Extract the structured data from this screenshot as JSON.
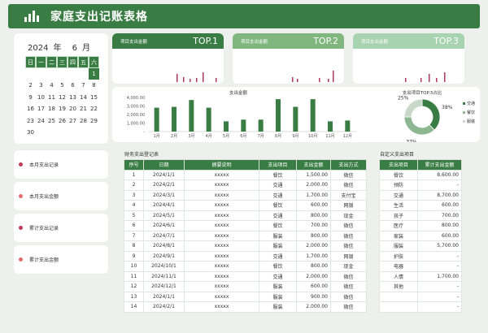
{
  "app": {
    "title": "家庭支出记账表格"
  },
  "calendar": {
    "year": "2024",
    "year_unit": "年",
    "month": "6",
    "month_unit": "月",
    "weekdays": [
      "日",
      "一",
      "二",
      "三",
      "四",
      "五",
      "六"
    ],
    "weeks": [
      [
        "",
        "",
        "",
        "",
        "",
        "",
        "1"
      ],
      [
        "2",
        "3",
        "4",
        "5",
        "6",
        "7",
        "8"
      ],
      [
        "9",
        "10",
        "11",
        "12",
        "13",
        "14",
        "15"
      ],
      [
        "16",
        "17",
        "18",
        "19",
        "20",
        "21",
        "22"
      ],
      [
        "23",
        "24",
        "25",
        "26",
        "27",
        "28",
        "29"
      ],
      [
        "30",
        "",
        "",
        "",
        "",
        "",
        ""
      ]
    ],
    "selected_day": "1"
  },
  "nav": [
    {
      "label": "本月支出记录",
      "dot_color": "#c0395b"
    },
    {
      "label": "本月支出金额",
      "dot_color": "#e86a6a"
    },
    {
      "label": "累计支出记录",
      "dot_color": "#c0395b"
    },
    {
      "label": "累计支出金额",
      "dot_color": "#e86a6a"
    }
  ],
  "top_cards": [
    {
      "label": "项目支出金额",
      "rank": "TOP.1",
      "color": "#3a7d44"
    },
    {
      "label": "项目支出金额",
      "rank": "TOP.2",
      "color": "#7fb77e"
    },
    {
      "label": "项目支出金额",
      "rank": "TOP.3",
      "color": "#a8d3b0"
    }
  ],
  "sections": {
    "ledger_title": "财务支出登记表",
    "custom_title": "自定义支出项目"
  },
  "chart_data": [
    {
      "type": "bar",
      "title": "支出金额",
      "categories": [
        "1月",
        "2月",
        "3月",
        "4月",
        "5月",
        "6月",
        "7月",
        "8月",
        "9月",
        "10月",
        "11月",
        "12月"
      ],
      "values": [
        2800,
        2900,
        3700,
        2800,
        1200,
        1400,
        1400,
        3800,
        2900,
        3800,
        1200,
        1300
      ],
      "y_ticks": [
        "4,000.00",
        "3,000.00",
        "2,000.00",
        "1,000.00",
        "-"
      ],
      "ylim": [
        0,
        4000
      ]
    },
    {
      "type": "pie",
      "title": "支出项目TOP.3占比",
      "labels": [
        "交通",
        "餐饮",
        "服装"
      ],
      "values": [
        38,
        37,
        25
      ],
      "value_labels": [
        "38%",
        "37%",
        "25%"
      ],
      "colors": [
        "#3a7d44",
        "#8cb790",
        "#c8d9c9"
      ]
    }
  ],
  "ledger": {
    "headers": [
      "序号",
      "日期",
      "摘要说明",
      "支出项目",
      "支出金额",
      "支出方式"
    ],
    "rows": [
      [
        "1",
        "2024/1/1",
        "xxxxx",
        "餐饮",
        "1,500.00",
        "微信"
      ],
      [
        "2",
        "2024/2/1",
        "xxxxx",
        "交通",
        "2,000.00",
        "微信"
      ],
      [
        "3",
        "2024/3/1",
        "xxxxx",
        "交通",
        "1,700.00",
        "支付宝"
      ],
      [
        "4",
        "2024/4/1",
        "xxxxx",
        "餐饮",
        "600.00",
        "网银"
      ],
      [
        "5",
        "2024/5/1",
        "xxxxx",
        "交通",
        "800.00",
        "现金"
      ],
      [
        "6",
        "2024/6/1",
        "xxxxx",
        "餐饮",
        "700.00",
        "微信"
      ],
      [
        "7",
        "2024/7/1",
        "xxxxx",
        "服装",
        "800.00",
        "微信"
      ],
      [
        "8",
        "2024/8/1",
        "xxxxx",
        "服装",
        "2,000.00",
        "微信"
      ],
      [
        "9",
        "2024/9/1",
        "xxxxx",
        "交通",
        "1,700.00",
        "网银"
      ],
      [
        "10",
        "2024/10/1",
        "xxxxx",
        "餐饮",
        "800.00",
        "现金"
      ],
      [
        "11",
        "2024/11/1",
        "xxxxx",
        "交通",
        "2,000.00",
        "微信"
      ],
      [
        "12",
        "2024/12/1",
        "xxxxx",
        "服装",
        "600.00",
        "微信"
      ],
      [
        "13",
        "2024/1/1",
        "xxxxx",
        "服装",
        "900.00",
        "微信"
      ],
      [
        "14",
        "2024/2/1",
        "xxxxx",
        "服装",
        "2,000.00",
        "微信"
      ]
    ]
  },
  "custom": {
    "headers": [
      "支出项目",
      "累计支出金额"
    ],
    "rows": [
      [
        "餐饮",
        "8,600.00"
      ],
      [
        "预防",
        "-"
      ],
      [
        "交通",
        "8,700.00"
      ],
      [
        "生活",
        "600.00"
      ],
      [
        "孩子",
        "700.00"
      ],
      [
        "医疗",
        "800.00"
      ],
      [
        "家装",
        "600.00"
      ],
      [
        "服装",
        "5,700.00"
      ],
      [
        "护肤",
        "-"
      ],
      [
        "电器",
        "-"
      ],
      [
        "人情",
        "1,700.00"
      ],
      [
        "其他",
        "-"
      ],
      [
        "",
        "-"
      ],
      [
        "",
        "-"
      ]
    ]
  }
}
